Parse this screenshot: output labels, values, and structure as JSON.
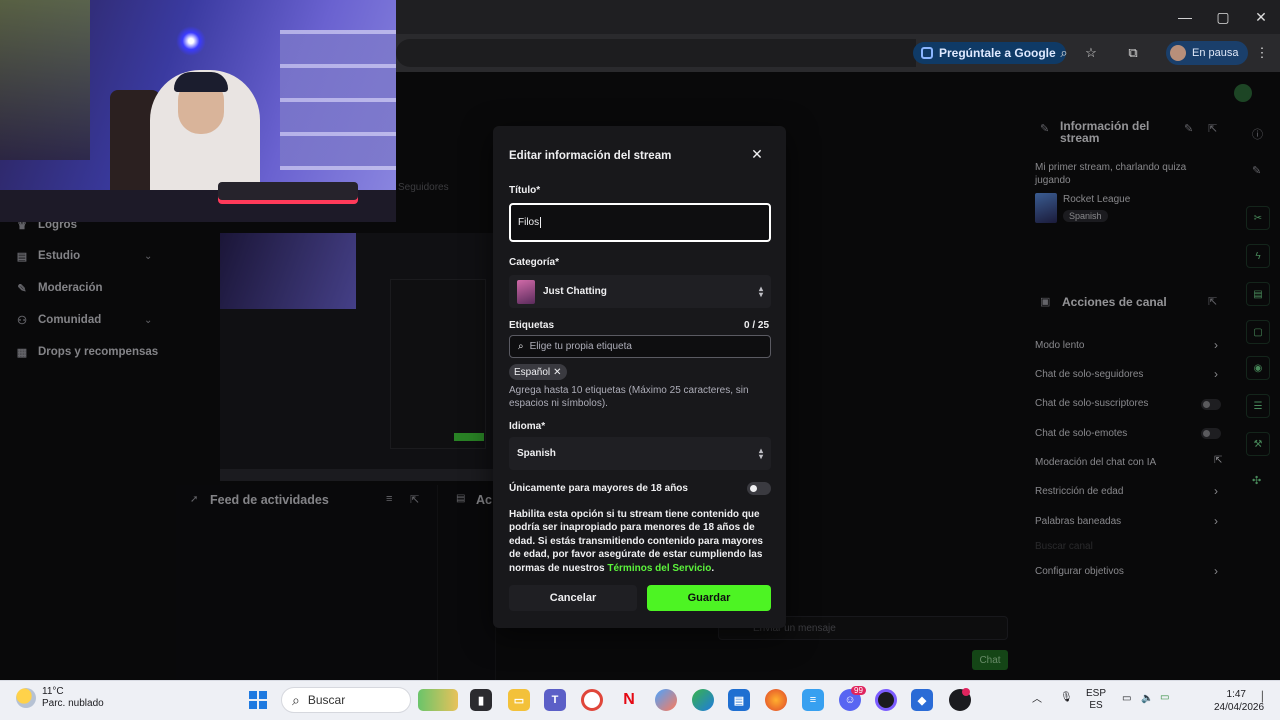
{
  "browser": {
    "ask_google": "Pregúntale a Google",
    "profile_status": "En pausa",
    "controls": {
      "minimize": "—",
      "maximize": "▢",
      "close": "✕"
    }
  },
  "sidebar": {
    "items": [
      {
        "label": "Logros",
        "icon": "trophy-icon"
      },
      {
        "label": "Estudio",
        "icon": "studio-icon",
        "expandable": true
      },
      {
        "label": "Moderación",
        "icon": "wrench-icon"
      },
      {
        "label": "Comunidad",
        "icon": "community-icon",
        "expandable": true
      },
      {
        "label": "Drops y recompensas",
        "icon": "gift-icon"
      }
    ],
    "partial_text": "Seguidores"
  },
  "panels": {
    "activity_feed": "Feed de actividades",
    "partial_next": "Ac",
    "chat_placeholder": "Enviar un mensaje",
    "chat_button": "Chat"
  },
  "stream_info": {
    "header": "Información del stream",
    "title": "Mi primer stream, charlando quiza jugando",
    "game": "Rocket League",
    "language": "Spanish"
  },
  "channel_actions": {
    "header": "Acciones de canal",
    "rows": [
      {
        "label": "Modo lento",
        "control": "chevron"
      },
      {
        "label": "Chat de solo-seguidores",
        "control": "chevron"
      },
      {
        "label": "Chat de solo-suscriptores",
        "control": "toggle"
      },
      {
        "label": "Chat de solo-emotes",
        "control": "toggle"
      },
      {
        "label": "Moderación del chat con IA",
        "control": "external"
      },
      {
        "label": "Restricción de edad",
        "control": "chevron"
      },
      {
        "label": "Palabras baneadas",
        "control": "chevron"
      },
      {
        "label": "Buscar canal",
        "control": "none"
      },
      {
        "label": "Configurar objetivos",
        "control": "chevron"
      }
    ]
  },
  "modal": {
    "title": "Editar información del stream",
    "title_label": "Título*",
    "title_value": "Filos",
    "category_label": "Categoría*",
    "category_value": "Just Chatting",
    "tags_label": "Etiquetas",
    "tags_count": "0 / 25",
    "tags_placeholder": "Elige tu propia etiqueta",
    "tag_chip": "Español",
    "tags_help": "Agrega hasta 10 etiquetas (Máximo 25 caracteres, sin espacios ni símbolos).",
    "language_label": "Idioma*",
    "language_value": "Spanish",
    "mature_label": "Únicamente para mayores de 18 años",
    "mature_enabled": false,
    "mature_text": "Habilita esta opción si tu stream tiene contenido que podría ser inapropiado para menores de 18 años de edad. Si estás transmitiendo contenido para mayores de edad, por favor asegúrate de estar cumpliendo las normas de nuestros",
    "tos_link": "Términos del Servicio",
    "tos_period": ".",
    "cancel": "Cancelar",
    "save": "Guardar"
  },
  "taskbar": {
    "weather_temp": "11°C",
    "weather_desc": "Parc. nublado",
    "search_placeholder": "Buscar",
    "lang_top": "ESP",
    "lang_bottom": "ES",
    "time": "1:47",
    "date": "24/04/2026",
    "badge_count": "99"
  },
  "colors": {
    "accent_green": "#4df423",
    "link_green": "#5cf33c",
    "modal_bg": "#18181b",
    "page_bg": "#0e0e10"
  }
}
